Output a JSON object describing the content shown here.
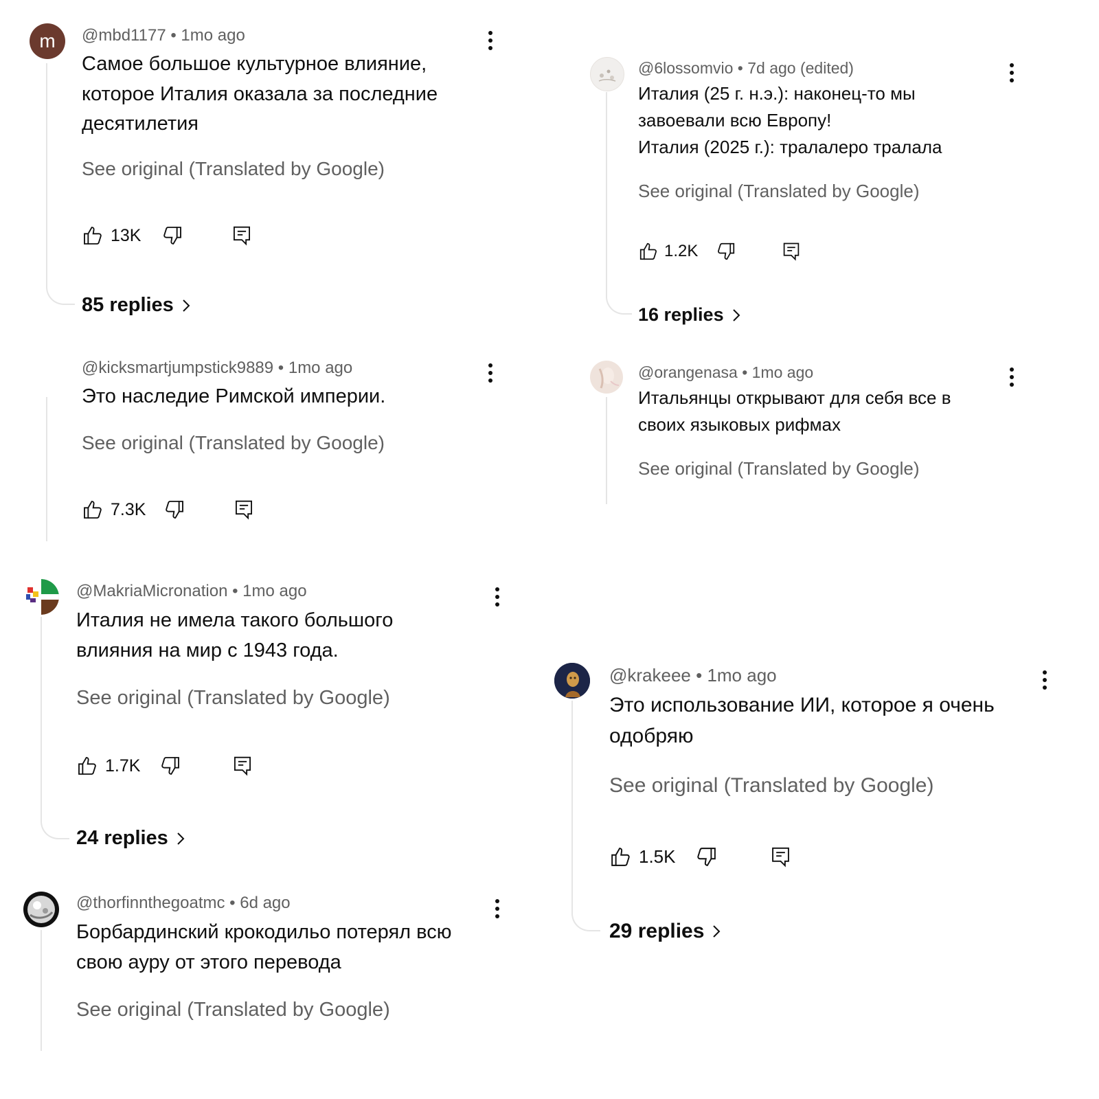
{
  "see_original_label": "See original (Translated by Google)",
  "comments": [
    {
      "author": "@mbd1177",
      "time": "1mo ago",
      "meta": "@mbd1177 • 1mo ago",
      "avatar_letter": "m",
      "avatar_color": "#6b3a2e",
      "text": "Самое большое культурное влияние, которое Италия оказала за последние десятилетия",
      "likes": "13K",
      "replies": "85 replies"
    },
    {
      "author": "@kicksmartjumpstick9889",
      "meta": "@kicksmartjumpstick9889 • 1mo ago",
      "text": "Это наследие Римской империи.",
      "likes": "7.3K"
    },
    {
      "author": "@6lossomvio",
      "meta": "@6lossomvio • 7d ago (edited)",
      "text_line1": "Италия (25 г. н.э.): наконец-то мы завоевали всю Европу!",
      "text_line2": "Италия (2025 г.): тралалеро тралала",
      "likes": "1.2K",
      "replies": "16 replies"
    },
    {
      "author": "@orangenasa",
      "meta": "@orangenasa • 1mo ago",
      "text": "Итальянцы открывают для себя все в своих языковых рифмах"
    },
    {
      "author": "@MakriaMicronation",
      "meta": "@MakriaMicronation • 1mo ago",
      "text": "Италия не имела такого большого влияния на мир с 1943 года.",
      "likes": "1.7K",
      "replies": "24 replies"
    },
    {
      "author": "@thorfinnthegoatmc",
      "meta": "@thorfinnthegoatmc • 6d ago",
      "text": "Борбардинский крокодильо потерял всю свою ауру от этого перевода"
    },
    {
      "author": "@krakeee",
      "meta": "@krakeee • 1mo ago",
      "text": "Это использование ИИ, которое я очень одобряю",
      "likes": "1.5K",
      "replies": "29 replies"
    }
  ],
  "icons": {
    "like": "thumbs-up-icon",
    "dislike": "thumbs-down-icon",
    "reply": "reply-comment-icon",
    "more": "more-vert-icon",
    "chevron": "chevron-right-icon"
  },
  "colors": {
    "meta_text": "#606060",
    "body_text": "#0f0f0f",
    "thread_line": "#e5e5e5"
  }
}
